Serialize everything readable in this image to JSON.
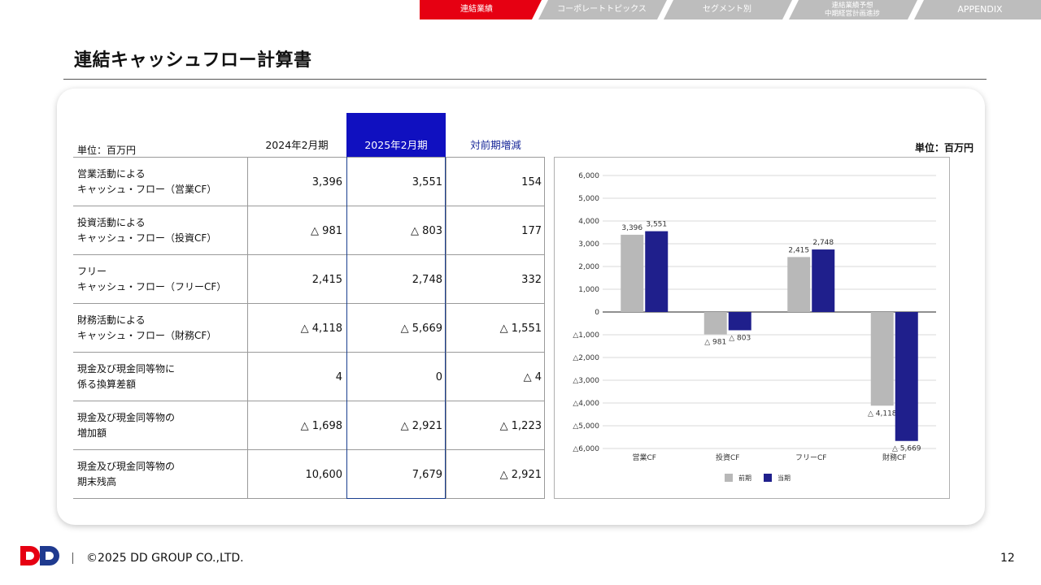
{
  "nav": {
    "tabs": [
      {
        "label": "連結業績",
        "active": true
      },
      {
        "label": "コーポレートトピックス",
        "active": false
      },
      {
        "label": "セグメント別",
        "active": false
      },
      {
        "label": "連結業績予想\n中期経営計画進捗",
        "active": false
      },
      {
        "label": "APPENDIX",
        "active": false
      }
    ],
    "active_color": "#e60012",
    "inactive_color": "#bdbdbd"
  },
  "page": {
    "title": "連結キャッシュフロー計算書",
    "number": "12",
    "copyright": "©2025 DD GROUP CO.,LTD."
  },
  "table": {
    "unit": "単位：百万円",
    "headers": [
      "2024年2月期",
      "2025年2月期",
      "対前期増減"
    ],
    "highlight_color": "#1010c0",
    "change_header_color": "#1a2a9a",
    "rows": [
      {
        "label": "営業活動による\nキャッシュ・フロー（営業CF）",
        "prev": "3,396",
        "curr": "3,551",
        "change": "154"
      },
      {
        "label": "投資活動による\nキャッシュ・フロー（投資CF）",
        "prev": "△ 981",
        "curr": "△ 803",
        "change": "177"
      },
      {
        "label": "フリー\nキャッシュ・フロー（フリーCF）",
        "prev": "2,415",
        "curr": "2,748",
        "change": "332"
      },
      {
        "label": "財務活動による\nキャッシュ・フロー（財務CF）",
        "prev": "△ 4,118",
        "curr": "△ 5,669",
        "change": "△ 1,551"
      },
      {
        "label": "現金及び現金同等物に\n係る換算差額",
        "prev": "4",
        "curr": "0",
        "change": "△ 4"
      },
      {
        "label": "現金及び現金同等物の\n増加額",
        "prev": "△ 1,698",
        "curr": "△ 2,921",
        "change": "△ 1,223"
      },
      {
        "label": "現金及び現金同等物の\n期末残高",
        "prev": "10,600",
        "curr": "7,679",
        "change": "△ 2,921"
      }
    ]
  },
  "chart_data": {
    "type": "bar",
    "unit": "単位：百万円",
    "categories": [
      "営業CF",
      "投資CF",
      "フリーCF",
      "財務CF"
    ],
    "series": [
      {
        "name": "前期",
        "values": [
          3396,
          -981,
          2415,
          -4118
        ],
        "labels": [
          "3,396",
          "△ 981",
          "2,415",
          "△ 4,118"
        ],
        "color": "#b8b8b8"
      },
      {
        "name": "当期",
        "values": [
          3551,
          -803,
          2748,
          -5669
        ],
        "labels": [
          "3,551",
          "△ 803",
          "2,748",
          "△ 5,669"
        ],
        "color": "#1f1f8c"
      }
    ],
    "ylim": [
      -6000,
      6000
    ],
    "yticks": [
      {
        "v": 6000,
        "label": "6,000"
      },
      {
        "v": 5000,
        "label": "5,000"
      },
      {
        "v": 4000,
        "label": "4,000"
      },
      {
        "v": 3000,
        "label": "3,000"
      },
      {
        "v": 2000,
        "label": "2,000"
      },
      {
        "v": 1000,
        "label": "1,000"
      },
      {
        "v": 0,
        "label": "0"
      },
      {
        "v": -1000,
        "label": "△1,000"
      },
      {
        "v": -2000,
        "label": "△2,000"
      },
      {
        "v": -3000,
        "label": "△3,000"
      },
      {
        "v": -4000,
        "label": "△4,000"
      },
      {
        "v": -5000,
        "label": "△5,000"
      },
      {
        "v": -6000,
        "label": "△6,000"
      }
    ],
    "grid": true,
    "legend": "bottom"
  }
}
